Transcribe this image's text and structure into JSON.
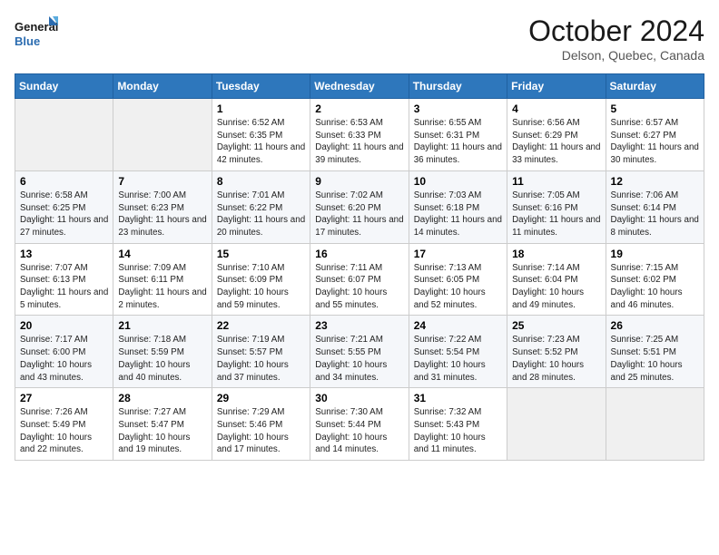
{
  "header": {
    "logo_line1": "General",
    "logo_line2": "Blue",
    "month": "October 2024",
    "location": "Delson, Quebec, Canada"
  },
  "weekdays": [
    "Sunday",
    "Monday",
    "Tuesday",
    "Wednesday",
    "Thursday",
    "Friday",
    "Saturday"
  ],
  "weeks": [
    [
      {
        "day": "",
        "info": ""
      },
      {
        "day": "",
        "info": ""
      },
      {
        "day": "1",
        "info": "Sunrise: 6:52 AM\nSunset: 6:35 PM\nDaylight: 11 hours and 42 minutes."
      },
      {
        "day": "2",
        "info": "Sunrise: 6:53 AM\nSunset: 6:33 PM\nDaylight: 11 hours and 39 minutes."
      },
      {
        "day": "3",
        "info": "Sunrise: 6:55 AM\nSunset: 6:31 PM\nDaylight: 11 hours and 36 minutes."
      },
      {
        "day": "4",
        "info": "Sunrise: 6:56 AM\nSunset: 6:29 PM\nDaylight: 11 hours and 33 minutes."
      },
      {
        "day": "5",
        "info": "Sunrise: 6:57 AM\nSunset: 6:27 PM\nDaylight: 11 hours and 30 minutes."
      }
    ],
    [
      {
        "day": "6",
        "info": "Sunrise: 6:58 AM\nSunset: 6:25 PM\nDaylight: 11 hours and 27 minutes."
      },
      {
        "day": "7",
        "info": "Sunrise: 7:00 AM\nSunset: 6:23 PM\nDaylight: 11 hours and 23 minutes."
      },
      {
        "day": "8",
        "info": "Sunrise: 7:01 AM\nSunset: 6:22 PM\nDaylight: 11 hours and 20 minutes."
      },
      {
        "day": "9",
        "info": "Sunrise: 7:02 AM\nSunset: 6:20 PM\nDaylight: 11 hours and 17 minutes."
      },
      {
        "day": "10",
        "info": "Sunrise: 7:03 AM\nSunset: 6:18 PM\nDaylight: 11 hours and 14 minutes."
      },
      {
        "day": "11",
        "info": "Sunrise: 7:05 AM\nSunset: 6:16 PM\nDaylight: 11 hours and 11 minutes."
      },
      {
        "day": "12",
        "info": "Sunrise: 7:06 AM\nSunset: 6:14 PM\nDaylight: 11 hours and 8 minutes."
      }
    ],
    [
      {
        "day": "13",
        "info": "Sunrise: 7:07 AM\nSunset: 6:13 PM\nDaylight: 11 hours and 5 minutes."
      },
      {
        "day": "14",
        "info": "Sunrise: 7:09 AM\nSunset: 6:11 PM\nDaylight: 11 hours and 2 minutes."
      },
      {
        "day": "15",
        "info": "Sunrise: 7:10 AM\nSunset: 6:09 PM\nDaylight: 10 hours and 59 minutes."
      },
      {
        "day": "16",
        "info": "Sunrise: 7:11 AM\nSunset: 6:07 PM\nDaylight: 10 hours and 55 minutes."
      },
      {
        "day": "17",
        "info": "Sunrise: 7:13 AM\nSunset: 6:05 PM\nDaylight: 10 hours and 52 minutes."
      },
      {
        "day": "18",
        "info": "Sunrise: 7:14 AM\nSunset: 6:04 PM\nDaylight: 10 hours and 49 minutes."
      },
      {
        "day": "19",
        "info": "Sunrise: 7:15 AM\nSunset: 6:02 PM\nDaylight: 10 hours and 46 minutes."
      }
    ],
    [
      {
        "day": "20",
        "info": "Sunrise: 7:17 AM\nSunset: 6:00 PM\nDaylight: 10 hours and 43 minutes."
      },
      {
        "day": "21",
        "info": "Sunrise: 7:18 AM\nSunset: 5:59 PM\nDaylight: 10 hours and 40 minutes."
      },
      {
        "day": "22",
        "info": "Sunrise: 7:19 AM\nSunset: 5:57 PM\nDaylight: 10 hours and 37 minutes."
      },
      {
        "day": "23",
        "info": "Sunrise: 7:21 AM\nSunset: 5:55 PM\nDaylight: 10 hours and 34 minutes."
      },
      {
        "day": "24",
        "info": "Sunrise: 7:22 AM\nSunset: 5:54 PM\nDaylight: 10 hours and 31 minutes."
      },
      {
        "day": "25",
        "info": "Sunrise: 7:23 AM\nSunset: 5:52 PM\nDaylight: 10 hours and 28 minutes."
      },
      {
        "day": "26",
        "info": "Sunrise: 7:25 AM\nSunset: 5:51 PM\nDaylight: 10 hours and 25 minutes."
      }
    ],
    [
      {
        "day": "27",
        "info": "Sunrise: 7:26 AM\nSunset: 5:49 PM\nDaylight: 10 hours and 22 minutes."
      },
      {
        "day": "28",
        "info": "Sunrise: 7:27 AM\nSunset: 5:47 PM\nDaylight: 10 hours and 19 minutes."
      },
      {
        "day": "29",
        "info": "Sunrise: 7:29 AM\nSunset: 5:46 PM\nDaylight: 10 hours and 17 minutes."
      },
      {
        "day": "30",
        "info": "Sunrise: 7:30 AM\nSunset: 5:44 PM\nDaylight: 10 hours and 14 minutes."
      },
      {
        "day": "31",
        "info": "Sunrise: 7:32 AM\nSunset: 5:43 PM\nDaylight: 10 hours and 11 minutes."
      },
      {
        "day": "",
        "info": ""
      },
      {
        "day": "",
        "info": ""
      }
    ]
  ]
}
